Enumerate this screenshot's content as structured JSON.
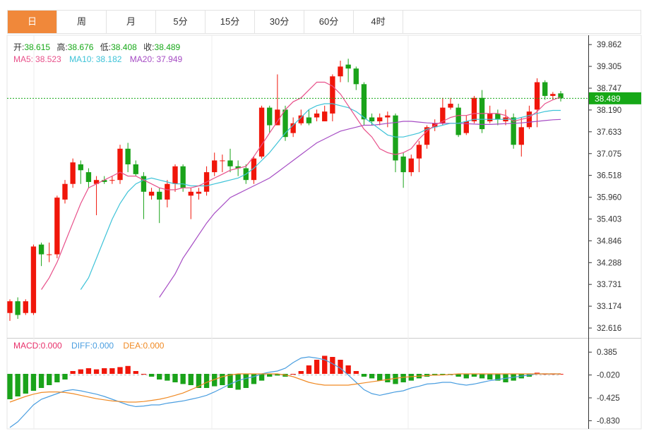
{
  "tabs": [
    "日",
    "周",
    "月",
    "5分",
    "15分",
    "30分",
    "60分",
    "4时"
  ],
  "active_tab": 0,
  "ohlc_info": {
    "open_label": "开:",
    "open": "38.615",
    "high_label": "高:",
    "high": "38.676",
    "low_label": "低:",
    "low": "38.408",
    "close_label": "收:",
    "close": "38.489"
  },
  "ma_info": {
    "ma5_label": "MA5:",
    "ma5": "38.523",
    "ma10_label": "MA10:",
    "ma10": "38.182",
    "ma20_label": "MA20:",
    "ma20": "37.949"
  },
  "macd_info": {
    "macd_label": "MACD:",
    "macd": "0.000",
    "diff_label": "DIFF:",
    "diff": "0.000",
    "dea_label": "DEA:",
    "dea": "0.000"
  },
  "current_price_tag": "38.489",
  "colors": {
    "up": "#f0160a",
    "down": "#1aa31a",
    "ma5": "#e8508a",
    "ma10": "#3ec3d8",
    "ma20": "#a64cc4",
    "diff": "#4a9ee0",
    "dea": "#f08a24",
    "tag": "#16a817",
    "active_tab": "#f0883a"
  },
  "chart_data": [
    {
      "type": "candlestick",
      "title": "",
      "ylim": [
        32.4,
        40.1
      ],
      "y_ticks": [
        "39.862",
        "39.305",
        "38.747",
        "38.190",
        "37.633",
        "37.075",
        "36.518",
        "35.960",
        "35.403",
        "34.846",
        "34.288",
        "33.731",
        "33.174",
        "32.616"
      ],
      "candles": [
        [
          33.0,
          33.3,
          33.35,
          32.8
        ],
        [
          33.3,
          32.95,
          33.4,
          32.85
        ],
        [
          33.0,
          33.3,
          33.35,
          32.95
        ],
        [
          33.0,
          34.7,
          34.75,
          32.95
        ],
        [
          34.75,
          34.5,
          34.8,
          34.2
        ],
        [
          34.5,
          34.5,
          34.8,
          34.3
        ],
        [
          34.5,
          35.95,
          36.0,
          34.4
        ],
        [
          35.9,
          36.3,
          36.4,
          35.8
        ],
        [
          36.3,
          36.85,
          36.95,
          36.2
        ],
        [
          36.8,
          36.65,
          36.9,
          36.3
        ],
        [
          36.6,
          36.35,
          36.7,
          36.2
        ],
        [
          36.3,
          36.4,
          36.5,
          35.5
        ],
        [
          36.4,
          36.35,
          36.5,
          36.3
        ],
        [
          36.4,
          36.4,
          36.5,
          36.3
        ],
        [
          36.4,
          37.2,
          37.3,
          36.3
        ],
        [
          37.2,
          36.8,
          37.35,
          36.6
        ],
        [
          36.8,
          36.55,
          36.9,
          36.5
        ],
        [
          36.5,
          36.1,
          36.6,
          35.4
        ],
        [
          36.0,
          36.1,
          36.2,
          35.9
        ],
        [
          36.1,
          35.9,
          36.2,
          35.3
        ],
        [
          35.9,
          36.3,
          36.4,
          35.7
        ],
        [
          36.3,
          36.75,
          36.8,
          36.1
        ],
        [
          36.75,
          36.2,
          36.8,
          36.1
        ],
        [
          36.0,
          36.1,
          36.2,
          35.4
        ],
        [
          36.05,
          36.1,
          36.2,
          35.9
        ],
        [
          36.1,
          36.6,
          36.75,
          36.0
        ],
        [
          36.6,
          36.9,
          37.1,
          36.5
        ],
        [
          36.9,
          36.9,
          37.05,
          36.6
        ],
        [
          36.9,
          36.75,
          37.2,
          36.6
        ],
        [
          36.75,
          36.7,
          36.9,
          36.5
        ],
        [
          36.7,
          36.4,
          36.8,
          36.3
        ],
        [
          36.4,
          36.95,
          37.0,
          36.3
        ],
        [
          37.0,
          38.25,
          38.3,
          36.95
        ],
        [
          38.25,
          37.8,
          38.3,
          37.6
        ],
        [
          37.8,
          38.2,
          39.1,
          37.8
        ],
        [
          38.2,
          37.5,
          38.3,
          37.4
        ],
        [
          37.6,
          37.85,
          38.0,
          37.5
        ],
        [
          37.85,
          38.05,
          38.2,
          37.8
        ],
        [
          38.0,
          37.85,
          38.2,
          37.8
        ],
        [
          38.0,
          38.1,
          38.2,
          37.9
        ],
        [
          37.9,
          38.15,
          38.3,
          37.9
        ],
        [
          38.1,
          39.05,
          39.1,
          37.9
        ],
        [
          39.05,
          39.3,
          39.45,
          38.9
        ],
        [
          39.35,
          39.25,
          39.5,
          38.9
        ],
        [
          39.25,
          38.85,
          39.3,
          38.7
        ],
        [
          38.85,
          37.95,
          38.9,
          37.8
        ],
        [
          38.0,
          37.9,
          38.1,
          37.8
        ],
        [
          37.9,
          38.0,
          38.1,
          37.8
        ],
        [
          38.0,
          38.05,
          38.15,
          37.75
        ],
        [
          38.05,
          36.9,
          38.1,
          36.6
        ],
        [
          37.0,
          36.6,
          37.1,
          36.2
        ],
        [
          36.6,
          36.95,
          37.05,
          36.5
        ],
        [
          36.95,
          37.3,
          37.4,
          36.6
        ],
        [
          37.3,
          37.75,
          37.8,
          37.2
        ],
        [
          37.75,
          37.85,
          37.95,
          37.65
        ],
        [
          37.85,
          38.25,
          38.5,
          37.8
        ],
        [
          38.25,
          38.35,
          38.5,
          38.2
        ],
        [
          38.25,
          37.55,
          38.35,
          37.5
        ],
        [
          37.6,
          37.9,
          38.05,
          37.55
        ],
        [
          37.9,
          38.5,
          38.55,
          37.85
        ],
        [
          38.5,
          37.7,
          38.7,
          37.6
        ],
        [
          37.9,
          38.1,
          38.3,
          37.85
        ],
        [
          38.1,
          37.95,
          38.2,
          37.8
        ],
        [
          37.9,
          38.0,
          38.2,
          37.8
        ],
        [
          38.0,
          37.3,
          38.1,
          37.2
        ],
        [
          37.3,
          37.75,
          38.0,
          37.0
        ],
        [
          37.75,
          38.15,
          38.3,
          37.7
        ],
        [
          38.2,
          38.9,
          39.0,
          37.75
        ],
        [
          38.9,
          38.55,
          38.95,
          38.45
        ],
        [
          38.55,
          38.6,
          38.65,
          38.45
        ],
        [
          38.615,
          38.489,
          38.676,
          38.408
        ]
      ],
      "ma5": [
        null,
        null,
        null,
        null,
        33.6,
        33.9,
        34.3,
        34.8,
        35.3,
        35.8,
        36.2,
        36.3,
        36.4,
        36.5,
        36.6,
        36.5,
        36.5,
        36.4,
        36.3,
        36.2,
        36.15,
        36.15,
        36.2,
        36.2,
        36.25,
        36.35,
        36.45,
        36.55,
        36.65,
        36.7,
        36.75,
        37.0,
        37.3,
        37.6,
        37.9,
        38.2,
        38.4,
        38.5,
        38.7,
        38.9,
        38.9,
        38.8,
        38.6,
        38.3,
        38.0,
        37.7,
        37.5,
        37.2,
        37.1,
        37.05,
        37.1,
        37.2,
        37.45,
        37.65,
        37.8,
        37.9,
        38.0,
        38.05,
        38.05,
        38.1,
        38.1,
        38.1,
        38.1,
        38.05,
        37.9,
        37.95,
        38.0,
        38.15,
        38.35,
        38.45,
        38.52
      ],
      "ma10": [
        null,
        null,
        null,
        null,
        null,
        null,
        null,
        null,
        null,
        33.6,
        33.9,
        34.4,
        34.9,
        35.4,
        35.8,
        36.1,
        36.3,
        36.4,
        36.45,
        36.4,
        36.35,
        36.3,
        36.3,
        36.25,
        36.25,
        36.25,
        36.3,
        36.35,
        36.4,
        36.45,
        36.55,
        36.7,
        36.9,
        37.1,
        37.35,
        37.6,
        37.8,
        38.0,
        38.2,
        38.3,
        38.35,
        38.35,
        38.3,
        38.25,
        38.15,
        38.0,
        37.85,
        37.7,
        37.55,
        37.5,
        37.5,
        37.55,
        37.6,
        37.7,
        37.75,
        37.8,
        37.85,
        37.85,
        37.9,
        37.95,
        37.95,
        37.95,
        37.95,
        37.95,
        37.95,
        38.0,
        38.05,
        38.1,
        38.15,
        38.18,
        38.18
      ],
      "ma20": [
        null,
        null,
        null,
        null,
        null,
        null,
        null,
        null,
        null,
        null,
        null,
        null,
        null,
        null,
        null,
        null,
        null,
        null,
        null,
        33.4,
        33.7,
        34.0,
        34.4,
        34.7,
        35.0,
        35.3,
        35.55,
        35.75,
        35.95,
        36.05,
        36.15,
        36.25,
        36.35,
        36.45,
        36.6,
        36.75,
        36.9,
        37.05,
        37.2,
        37.35,
        37.45,
        37.55,
        37.65,
        37.7,
        37.75,
        37.8,
        37.8,
        37.82,
        37.85,
        37.87,
        37.9,
        37.9,
        37.88,
        37.86,
        37.85,
        37.85,
        37.85,
        37.85,
        37.84,
        37.83,
        37.82,
        37.82,
        37.83,
        37.84,
        37.85,
        37.86,
        37.88,
        37.9,
        37.92,
        37.94,
        37.949
      ]
    },
    {
      "type": "bar-line",
      "title": "",
      "ylim": [
        -0.95,
        0.6
      ],
      "y_ticks": [
        "0.385",
        "-0.020",
        "-0.425",
        "-0.830"
      ],
      "macd": [
        -0.45,
        -0.4,
        -0.35,
        -0.3,
        -0.25,
        -0.2,
        -0.15,
        -0.1,
        0.05,
        0.08,
        0.1,
        0.08,
        0.1,
        0.1,
        0.12,
        0.14,
        0.05,
        0.0,
        -0.05,
        -0.1,
        -0.12,
        -0.15,
        -0.18,
        -0.2,
        -0.25,
        -0.25,
        -0.22,
        -0.2,
        -0.25,
        -0.28,
        -0.25,
        -0.18,
        -0.12,
        -0.05,
        -0.03,
        -0.05,
        0.0,
        0.05,
        0.15,
        0.25,
        0.32,
        0.3,
        0.25,
        0.15,
        0.05,
        -0.05,
        -0.08,
        -0.12,
        -0.15,
        -0.18,
        -0.15,
        -0.12,
        -0.08,
        -0.05,
        -0.03,
        -0.02,
        -0.02,
        -0.05,
        -0.08,
        -0.05,
        -0.08,
        -0.1,
        -0.12,
        -0.15,
        -0.12,
        -0.08,
        -0.05,
        0.02,
        0.0,
        0.0,
        0.0
      ],
      "diff": [
        -0.95,
        -0.85,
        -0.7,
        -0.55,
        -0.45,
        -0.4,
        -0.35,
        -0.3,
        -0.28,
        -0.3,
        -0.33,
        -0.36,
        -0.4,
        -0.45,
        -0.5,
        -0.55,
        -0.58,
        -0.57,
        -0.55,
        -0.55,
        -0.52,
        -0.5,
        -0.48,
        -0.45,
        -0.42,
        -0.38,
        -0.32,
        -0.25,
        -0.18,
        -0.12,
        -0.08,
        -0.05,
        0.0,
        0.03,
        0.05,
        0.1,
        0.2,
        0.28,
        0.3,
        0.28,
        0.25,
        0.18,
        0.1,
        -0.02,
        -0.15,
        -0.28,
        -0.35,
        -0.38,
        -0.35,
        -0.32,
        -0.3,
        -0.25,
        -0.22,
        -0.18,
        -0.17,
        -0.15,
        -0.15,
        -0.18,
        -0.2,
        -0.18,
        -0.15,
        -0.12,
        -0.1,
        -0.08,
        -0.06,
        -0.04,
        -0.02,
        0.0,
        0.0,
        0.0,
        0.0
      ],
      "dea": [
        -0.5,
        -0.45,
        -0.4,
        -0.36,
        -0.33,
        -0.32,
        -0.32,
        -0.33,
        -0.35,
        -0.38,
        -0.41,
        -0.44,
        -0.46,
        -0.48,
        -0.49,
        -0.5,
        -0.5,
        -0.49,
        -0.47,
        -0.45,
        -0.42,
        -0.38,
        -0.34,
        -0.28,
        -0.22,
        -0.15,
        -0.1,
        -0.05,
        -0.02,
        0.0,
        0.0,
        0.0,
        0.0,
        0.0,
        0.0,
        -0.02,
        -0.05,
        -0.1,
        -0.15,
        -0.18,
        -0.2,
        -0.2,
        -0.2,
        -0.2,
        -0.18,
        -0.16,
        -0.14,
        -0.12,
        -0.1,
        -0.08,
        -0.06,
        -0.05,
        -0.04,
        -0.03,
        -0.02,
        -0.02,
        -0.01,
        0.0,
        0.0,
        0.0,
        0.0,
        0.0,
        0.0,
        0.0,
        0.0,
        0.0,
        0.0,
        0.0,
        0.0,
        0.0,
        0.0
      ]
    }
  ]
}
